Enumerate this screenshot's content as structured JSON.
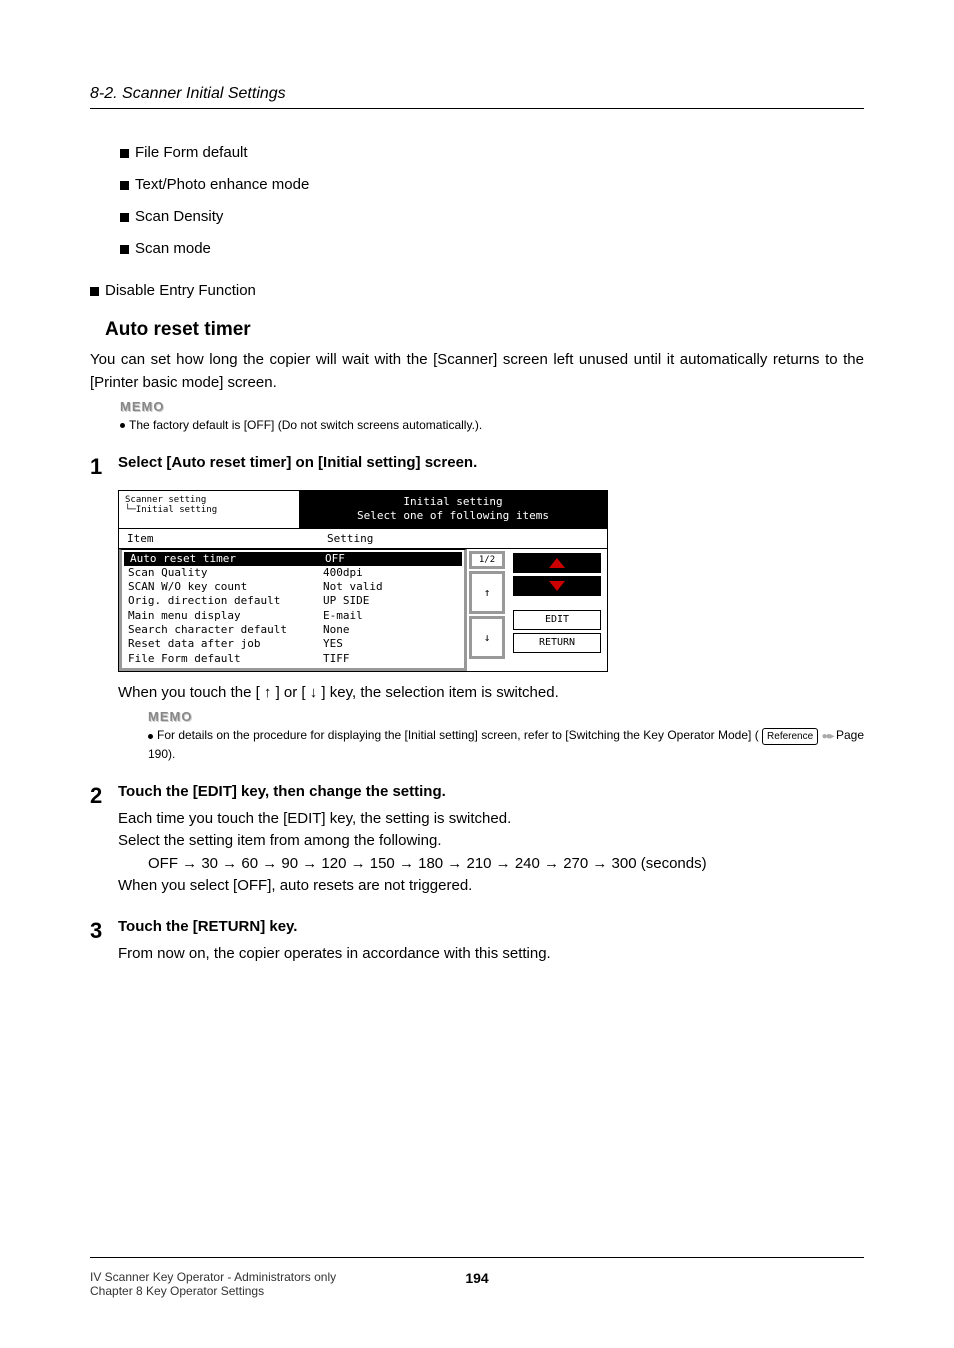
{
  "header": {
    "section": "8-2. Scanner Initial Settings"
  },
  "bullets": [
    "File Form default",
    "Text/Photo enhance mode",
    "Scan Density",
    "Scan mode",
    "Disable Entry Function"
  ],
  "heading": "Auto reset timer",
  "intro": "You can set how long the copier will wait with the [Scanner] screen left unused until it automatically returns to the [Printer basic mode] screen.",
  "memo1": {
    "label": "MEMO",
    "text": "The factory default is [OFF] (Do not switch screens automatically.)."
  },
  "step1": {
    "num": "1",
    "title": "Select [Auto reset timer] on [Initial setting] screen.",
    "after_img": "When you touch the [ ↑ ] or [ ↓ ] key, the selection item is switched."
  },
  "screen": {
    "breadcrumb1": "Scanner setting",
    "breadcrumb2": "Initial setting",
    "title1": "Initial setting",
    "title2": "Select one of following items",
    "col_item": "Item",
    "col_setting": "Setting",
    "page": "1/2",
    "rows": [
      {
        "label": "Auto reset timer",
        "value": "OFF",
        "selected": true
      },
      {
        "label": "Scan Quality",
        "value": "400dpi",
        "selected": false
      },
      {
        "label": "SCAN W/O key count",
        "value": "Not valid",
        "selected": false
      },
      {
        "label": "Orig. direction default",
        "value": "UP SIDE",
        "selected": false
      },
      {
        "label": "Main menu display",
        "value": "E-mail",
        "selected": false
      },
      {
        "label": "Search character default",
        "value": "None",
        "selected": false
      },
      {
        "label": "Reset data after job",
        "value": "YES",
        "selected": false
      },
      {
        "label": "File Form default",
        "value": "TIFF",
        "selected": false
      }
    ],
    "btn_edit": "EDIT",
    "btn_return": "RETURN"
  },
  "memo2": {
    "label": "MEMO",
    "text_prefix": "For details on the procedure for displaying the [Initial setting] screen, refer to [Switching the Key Operator Mode] ( ",
    "reference": "Reference",
    "text_suffix": "  Page 190)."
  },
  "step2": {
    "num": "2",
    "title": "Touch the [EDIT] key, then change the setting.",
    "line1": "Each time you touch the [EDIT] key, the setting is switched.",
    "line2": "Select the setting item from among the following.",
    "line3": "OFF → 30 → 60 → 90 → 120 → 150 → 180 → 210 → 240 → 270 → 300 (seconds)",
    "line4": "When you select [OFF], auto resets are not triggered."
  },
  "step3": {
    "num": "3",
    "title": "Touch the [RETURN] key.",
    "line1": "From now on, the copier operates in accordance with this setting."
  },
  "footer": {
    "line1": "IV Scanner Key Operator - Administrators only",
    "line2": "Chapter 8 Key Operator Settings",
    "page": "194"
  }
}
